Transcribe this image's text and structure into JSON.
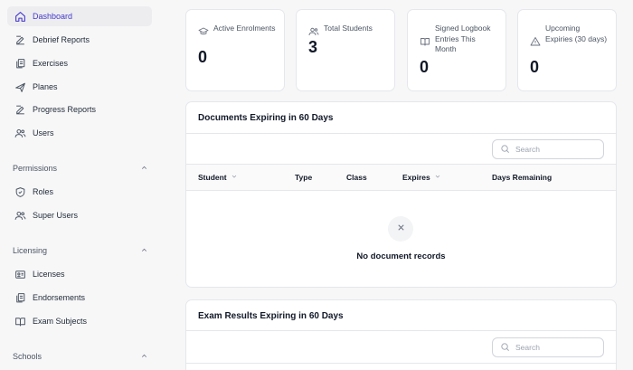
{
  "sidebar": {
    "items": [
      {
        "label": "Dashboard",
        "icon": "home-icon",
        "active": true
      },
      {
        "label": "Debrief Reports",
        "icon": "edit-icon"
      },
      {
        "label": "Exercises",
        "icon": "documents-icon"
      },
      {
        "label": "Planes",
        "icon": "plane-icon"
      },
      {
        "label": "Progress Reports",
        "icon": "edit-icon"
      },
      {
        "label": "Users",
        "icon": "users-icon"
      }
    ],
    "sections": [
      {
        "title": "Permissions",
        "items": [
          {
            "label": "Roles",
            "icon": "shield-icon"
          },
          {
            "label": "Super Users",
            "icon": "users-icon"
          }
        ]
      },
      {
        "title": "Licensing",
        "items": [
          {
            "label": "Licenses",
            "icon": "id-card-icon"
          },
          {
            "label": "Endorsements",
            "icon": "documents-icon"
          },
          {
            "label": "Exam Subjects",
            "icon": "book-open-icon"
          }
        ]
      },
      {
        "title": "Schools",
        "items": []
      }
    ]
  },
  "stats": [
    {
      "label": "Active Enrolments",
      "value": "0",
      "icon": "graduation-cap-icon"
    },
    {
      "label": "Total Students",
      "value": "3",
      "icon": "users-icon"
    },
    {
      "label": "Signed Logbook Entries This Month",
      "value": "0",
      "icon": "book-open-icon"
    },
    {
      "label": "Upcoming Expiries (30 days)",
      "value": "0",
      "icon": "warning-icon"
    }
  ],
  "documents_table": {
    "title": "Documents Expiring in 60 Days",
    "search_placeholder": "Search",
    "columns": [
      "Student",
      "Type",
      "Class",
      "Expires",
      "Days Remaining"
    ],
    "empty_text": "No document records"
  },
  "exams_table": {
    "title": "Exam Results Expiring in 60 Days",
    "search_placeholder": "Search"
  },
  "colors": {
    "accent": "#4338ca",
    "background": "#f7f7f8",
    "card": "#ffffff",
    "border": "#e5e7eb"
  }
}
